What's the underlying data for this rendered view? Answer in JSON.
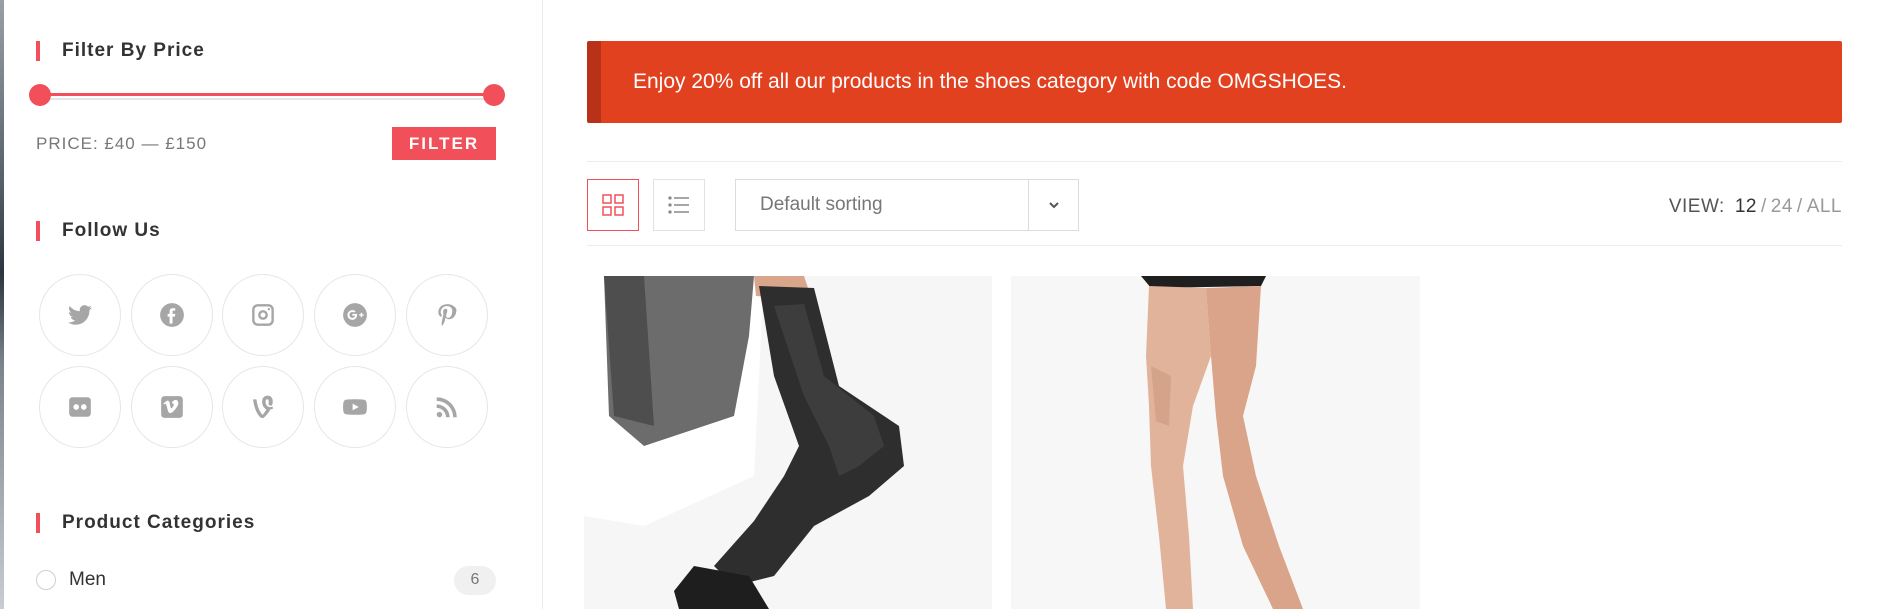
{
  "sidebar": {
    "price_widget": {
      "title": "Filter By Price",
      "price_label": "PRICE: £40 — £150",
      "filter_button": "FILTER"
    },
    "follow_widget": {
      "title": "Follow Us",
      "icons": [
        "twitter-icon",
        "facebook-icon",
        "instagram-icon",
        "google-plus-icon",
        "pinterest-icon",
        "flickr-icon",
        "vimeo-icon",
        "vine-icon",
        "youtube-icon",
        "rss-icon"
      ]
    },
    "categories_widget": {
      "title": "Product Categories",
      "items": [
        {
          "label": "Men",
          "count": "6"
        }
      ]
    }
  },
  "main": {
    "notice": "Enjoy 20% off all our products in the shoes category with code OMGSHOES.",
    "toolbar": {
      "sort_selected": "Default sorting",
      "view_label": "VIEW:",
      "view_options": [
        "12",
        "24",
        "ALL"
      ],
      "view_sep": "/"
    }
  },
  "colors": {
    "accent": "#f1505a",
    "notice_bg": "#e2411f",
    "notice_border": "#b8321a",
    "icon_gray": "#a6a6a6"
  }
}
